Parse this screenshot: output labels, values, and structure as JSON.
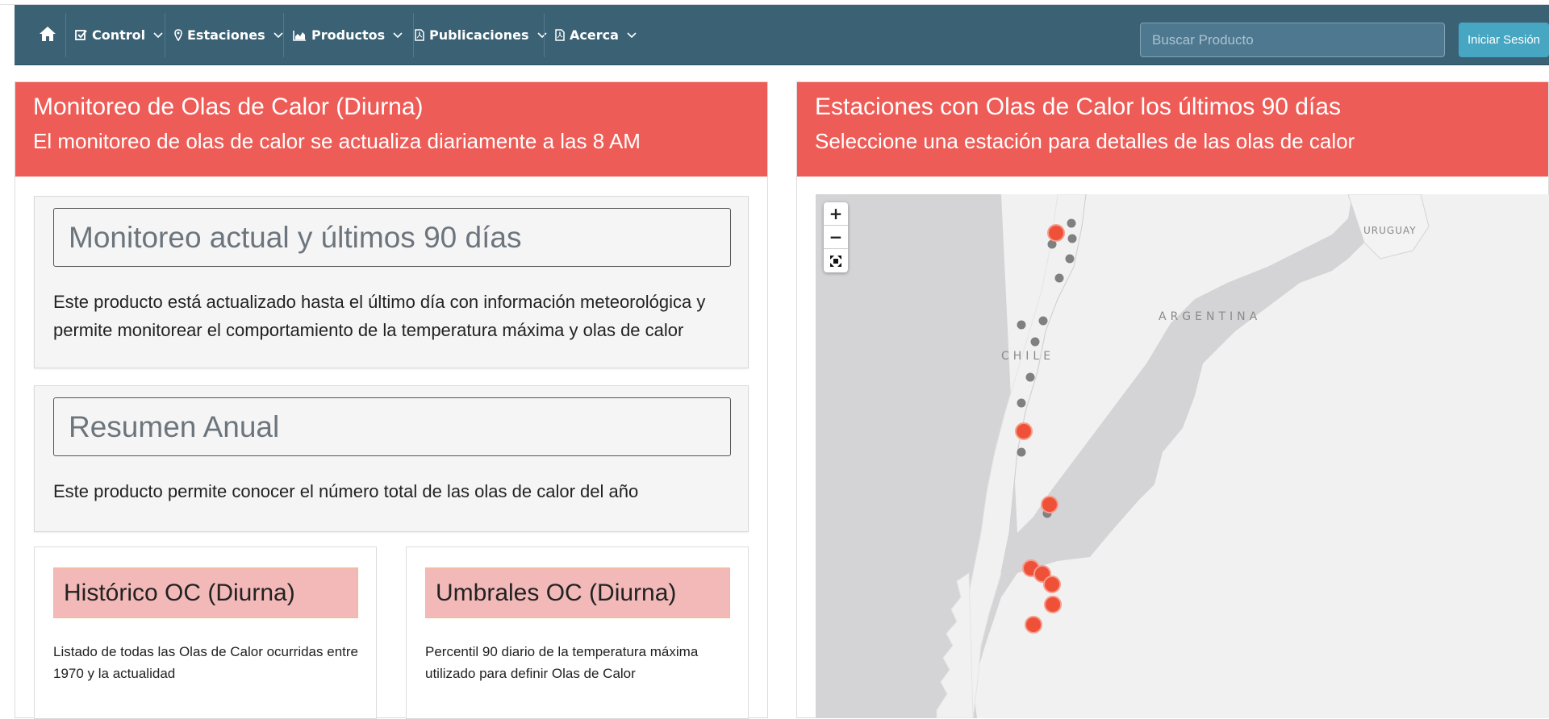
{
  "nav": {
    "items": [
      {
        "label": "Control",
        "icon": "check-square-icon"
      },
      {
        "label": "Estaciones",
        "icon": "map-marker-icon"
      },
      {
        "label": "Productos",
        "icon": "area-chart-icon"
      },
      {
        "label": "Publicaciones",
        "icon": "file-pdf-icon"
      },
      {
        "label": "Acerca",
        "icon": "file-pdf-icon"
      }
    ],
    "search_placeholder": "Buscar Producto",
    "login_label": "Iniciar Sesión"
  },
  "left_panel": {
    "title": "Monitoreo de Olas de Calor (Diurna)",
    "subtitle": "El monitoreo de olas de calor se actualiza diariamente a las 8 AM",
    "well1": {
      "title": "Monitoreo actual y últimos 90 días",
      "text_line1": "Este producto está actualizado hasta el último día con información meteorológica y",
      "text_line2": "permite monitorear el comportamiento de la temperatura máxima y olas de calor"
    },
    "well2": {
      "title": "Resumen Anual",
      "text": "Este producto permite conocer el número total de las olas de calor del año"
    },
    "card1": {
      "title": "Histórico OC (Diurna)",
      "text_line1": "Listado de todas las Olas de Calor ocurridas entre",
      "text_line2": "1970 y la actualidad"
    },
    "card2": {
      "title": "Umbrales OC (Diurna)",
      "text_line1": "Percentil 90 diario de la temperatura máxima",
      "text_line2": "utilizado para definir Olas de Calor"
    }
  },
  "right_panel": {
    "title": "Estaciones con Olas de Calor los últimos 90 días",
    "subtitle": "Seleccione una estación para detalles de las olas de calor",
    "map": {
      "zoom_in": "+",
      "zoom_out": "−",
      "labels": {
        "uruguay": "URUGUAY",
        "argentina": "ARGENTINA",
        "chile": "CHILE"
      },
      "colors": {
        "heatwave_marker": "#ef5138",
        "station_marker": "#808080",
        "land": "#f1f1f1",
        "water": "#d4d4d6"
      }
    }
  }
}
